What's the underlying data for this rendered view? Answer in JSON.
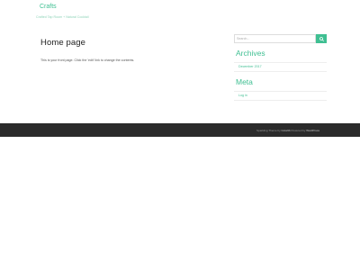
{
  "site": {
    "title": "Crafts",
    "tagline": "Crafted Tap Room + Natural Cocktail"
  },
  "main": {
    "page_title": "Home page",
    "content": "This is your front page. Click the 'edit' link to change the contents."
  },
  "sidebar": {
    "search": {
      "placeholder": "Search...",
      "value": ""
    },
    "archives": {
      "title": "Archives",
      "items": [
        "December 2017"
      ]
    },
    "meta": {
      "title": "Meta",
      "items": [
        "Log in"
      ]
    }
  },
  "footer": {
    "prefix": "Sparkling Theme by ",
    "theme_author": "Colorlib",
    "middle": " Powered by ",
    "platform": "WordPress"
  },
  "colors": {
    "accent": "#3fbf92",
    "footer_bg": "#2b2b2b"
  },
  "icons": {
    "search_button": "search-icon"
  }
}
